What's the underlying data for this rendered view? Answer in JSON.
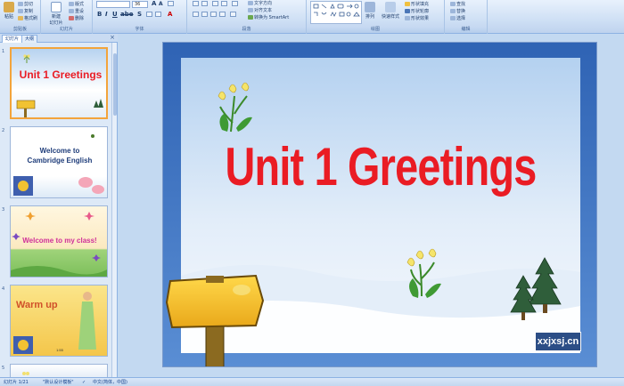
{
  "ribbon": {
    "clipboard": {
      "paste": "粘贴",
      "cut": "剪切",
      "copy": "复制",
      "format_painter": "格式刷",
      "group": "剪贴板"
    },
    "slides": {
      "new_slide": "新建\n幻灯片",
      "layout": "版式",
      "reset": "重设",
      "delete": "删除",
      "group": "幻灯片"
    },
    "font": {
      "size": "36",
      "group": "字体"
    },
    "paragraph": {
      "text_direction": "文字方向",
      "align_text": "对齐文本",
      "smartart": "转换为 SmartArt",
      "group": "段落"
    },
    "drawing": {
      "arrange": "排列",
      "quick_styles": "快速样式",
      "shape_fill": "形状填充",
      "shape_outline": "形状轮廓",
      "shape_effects": "形状效果",
      "group": "绘图"
    },
    "editing": {
      "find": "查找",
      "replace": "替换",
      "select": "选择",
      "group": "编辑"
    }
  },
  "panel": {
    "tabs": [
      "幻灯片",
      "大纲"
    ],
    "close": "×",
    "slides": [
      {
        "num": "1",
        "title": "Unit 1 Greetings"
      },
      {
        "num": "2",
        "title_line1": "Welcome to",
        "title_line2": "Cambridge English"
      },
      {
        "num": "3",
        "title": "Welcome to my class!"
      },
      {
        "num": "4",
        "title": "Warm up",
        "caption": "1:55"
      },
      {
        "num": "5"
      }
    ]
  },
  "slide": {
    "title": "Unit 1 Greetings",
    "watermark": "xxjxsj.cn"
  },
  "status": {
    "slide_pos": "幻灯片 1/21",
    "theme": "\"默认设计模板\"",
    "language": "中文(简体，中国)"
  },
  "colors": {
    "title_red": "#ea1c24",
    "selection_orange": "#f3a43b",
    "chrome_blue": "#c3d9f1"
  }
}
